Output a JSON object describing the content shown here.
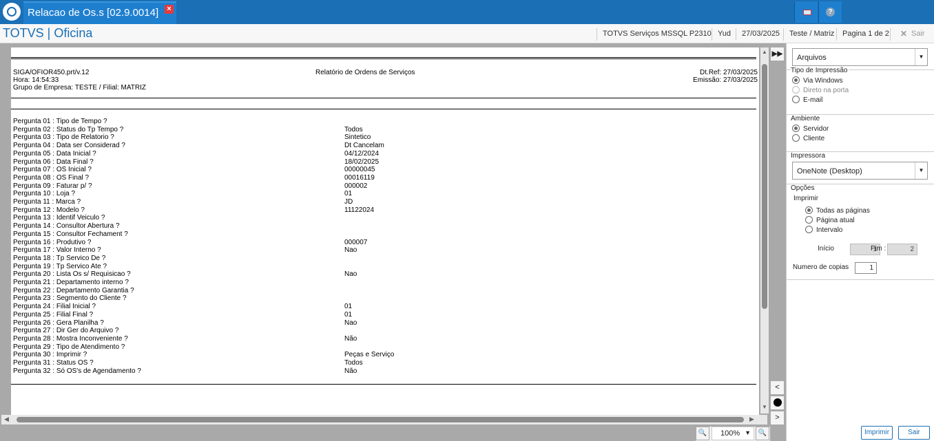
{
  "titlebar": {
    "tab_title": "Relacao de Os.s [02.9.0014]",
    "close_glyph": "×"
  },
  "header": {
    "brand": "TOTVS | Oficina",
    "environment": "TOTVS Serviços MSSQL P2310",
    "user": "Yud",
    "date": "27/03/2025",
    "company": "Teste / Matriz",
    "page": "Pagina 1 de 2",
    "exit": "Sair"
  },
  "report": {
    "program": "SIGA/OFIOR450.prt/v.12",
    "time": "Hora: 14:54:33",
    "group": "Grupo de Empresa: TESTE / Filial: MATRIZ",
    "title": "Relatório de Ordens de Serviços",
    "dt_ref": "Dt.Ref: 27/03/2025",
    "emission": "Emissão: 27/03/2025",
    "questions": [
      {
        "q": "Pergunta 01 : Tipo de Tempo ?",
        "a": ""
      },
      {
        "q": "Pergunta 02 : Status do Tp Tempo ?",
        "a": "Todos"
      },
      {
        "q": "Pergunta 03 : Tipo de Relatorio ?",
        "a": "Sintetico"
      },
      {
        "q": "Pergunta 04 : Data ser Considerad ?",
        "a": "Dt Cancelam"
      },
      {
        "q": "Pergunta 05 : Data Inicial ?",
        "a": "04/12/2024"
      },
      {
        "q": "Pergunta 06 : Data Final ?",
        "a": "18/02/2025"
      },
      {
        "q": "Pergunta 07 : OS Inicial ?",
        "a": "00000045"
      },
      {
        "q": "Pergunta 08 : OS Final ?",
        "a": "00016119"
      },
      {
        "q": "Pergunta 09 : Faturar p/ ?",
        "a": "000002"
      },
      {
        "q": "Pergunta 10 : Loja ?",
        "a": "01"
      },
      {
        "q": "Pergunta 11 : Marca ?",
        "a": "JD"
      },
      {
        "q": "Pergunta 12 : Modelo ?",
        "a": "11122024"
      },
      {
        "q": "Pergunta 13 : Identif Veiculo ?",
        "a": ""
      },
      {
        "q": "Pergunta 14 : Consultor Abertura ?",
        "a": ""
      },
      {
        "q": "Pergunta 15 : Consultor Fechament ?",
        "a": ""
      },
      {
        "q": "Pergunta 16 : Produtivo ?",
        "a": "000007"
      },
      {
        "q": "Pergunta 17 : Valor  Interno ?",
        "a": "Nao"
      },
      {
        "q": "Pergunta 18 : Tp Servico De ?",
        "a": ""
      },
      {
        "q": "Pergunta 19 : Tp Servico Ate ?",
        "a": ""
      },
      {
        "q": "Pergunta 20 : Lista Os s/ Requisicao ?",
        "a": "Nao"
      },
      {
        "q": "Pergunta 21 : Departamento interno ?",
        "a": ""
      },
      {
        "q": "Pergunta 22 : Departamento Garantia ?",
        "a": ""
      },
      {
        "q": "Pergunta 23 : Segmento do Cliente ?",
        "a": ""
      },
      {
        "q": "Pergunta 24 : Filial Inicial ?",
        "a": "01"
      },
      {
        "q": "Pergunta 25 : Filial Final ?",
        "a": "01"
      },
      {
        "q": "Pergunta 26 : Gera Planilha ?",
        "a": "Nao"
      },
      {
        "q": "Pergunta 27 : Dir Ger do Arquivo ?",
        "a": ""
      },
      {
        "q": "Pergunta 28 : Mostra Inconveniente ?",
        "a": "Não"
      },
      {
        "q": "Pergunta 29 : Tipo de Atendimento ?",
        "a": ""
      },
      {
        "q": "Pergunta 30 : Imprimir ?",
        "a": "Peças e Serviço"
      },
      {
        "q": "Pergunta 31 : Status OS ?",
        "a": "Todos"
      },
      {
        "q": "Pergunta 32 : Só OS's de Agendamento ?",
        "a": "Não"
      }
    ]
  },
  "viewer": {
    "zoom": "100%",
    "zoom_in": "🔍",
    "zoom_out": "🔍",
    "fast_forward": "▶▶",
    "prev": "<",
    "next": ">",
    "left_arrow": "◀",
    "right_arrow": "▶",
    "up_arrow": "▲",
    "down_arrow": "▼",
    "dropdown_arrow": "▼"
  },
  "panel": {
    "output_select": "Arquivos",
    "print_type_title": "Tipo de Impressão",
    "print_type_options": [
      "Via Windows",
      "Direto na porta",
      "E-mail"
    ],
    "environment_title": "Ambiente",
    "environment_options": [
      "Servidor",
      "Cliente"
    ],
    "printer_title": "Impressora",
    "printer_select": "OneNote (Desktop)",
    "options_title": "Opções",
    "print_label": "Imprimir",
    "page_options": [
      "Todas as páginas",
      "Página atual",
      "Intervalo"
    ],
    "start_label": "Início",
    "start_value": "1",
    "end_label": "Fim :",
    "end_value": "2",
    "copies_label": "Numero de copias",
    "copies_value": "1",
    "print_button": "Imprimir",
    "exit_button": "Sair"
  }
}
